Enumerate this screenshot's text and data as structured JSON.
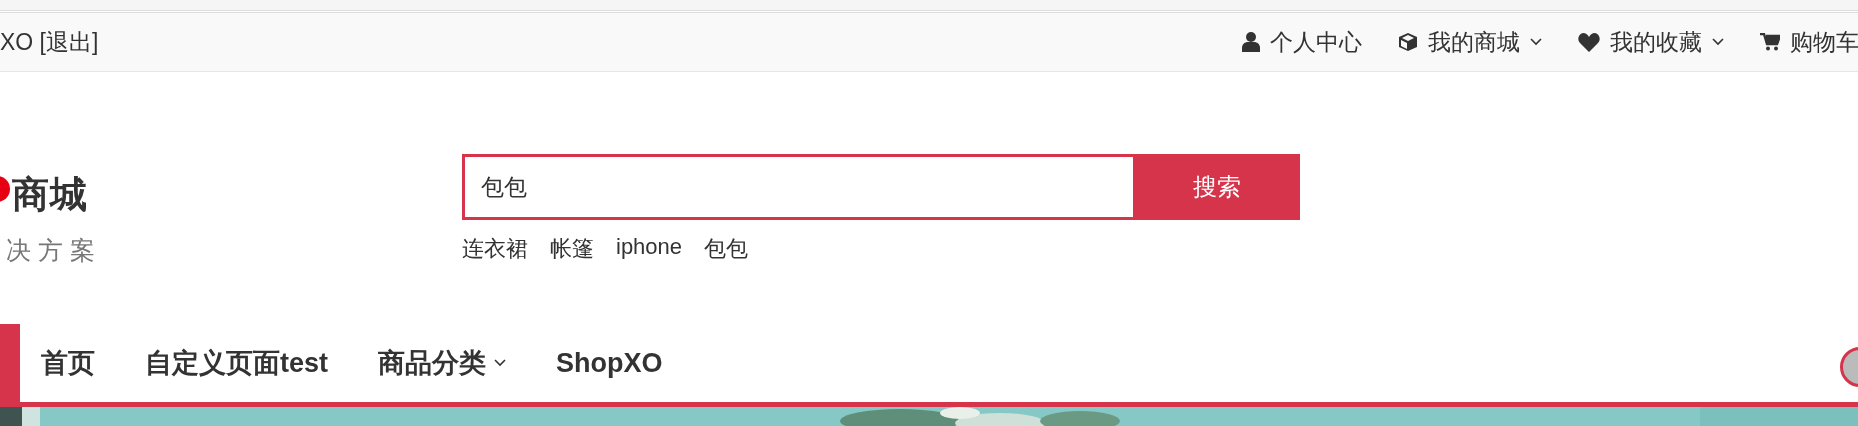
{
  "top_bar": {
    "user_text": "XO [退出]",
    "links": [
      {
        "label": "个人中心",
        "kind": "user",
        "dropdown": false
      },
      {
        "label": "我的商城",
        "kind": "box",
        "dropdown": true
      },
      {
        "label": "我的收藏",
        "kind": "heart",
        "dropdown": true
      },
      {
        "label": "购物车",
        "kind": "cart",
        "dropdown": false
      }
    ]
  },
  "logo": {
    "title": "商城",
    "tagline": "决方案"
  },
  "search": {
    "value": "包包",
    "button": "搜索",
    "hot_words": [
      "连衣裙",
      "帐篷",
      "iphone",
      "包包"
    ]
  },
  "nav": {
    "items": [
      {
        "label": "首页",
        "dropdown": false
      },
      {
        "label": "自定义页面test",
        "dropdown": false
      },
      {
        "label": "商品分类",
        "dropdown": true
      },
      {
        "label": "ShopXO",
        "dropdown": false
      }
    ]
  }
}
